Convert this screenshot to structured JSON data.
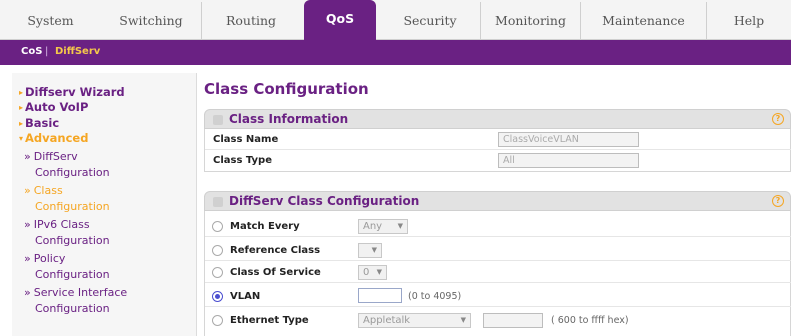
{
  "top_tabs": [
    "System",
    "Switching",
    "Routing",
    "QoS",
    "Security",
    "Monitoring",
    "Maintenance",
    "Help"
  ],
  "active_tab": "QoS",
  "sub_nav": {
    "items": [
      "CoS",
      "DiffServ"
    ],
    "divider": "|",
    "active": "DiffServ"
  },
  "sidebar": {
    "diffserv_wizard": "Diffserv Wizard",
    "auto_voip": "Auto VoIP",
    "basic": "Basic",
    "advanced": "Advanced",
    "diffserv_line1": "DiffServ",
    "diffserv_line2": "Configuration",
    "class_line1": "Class",
    "class_line2": "Configuration",
    "ipv6_line1": "IPv6 Class",
    "ipv6_line2": "Configuration",
    "policy_line1": "Policy",
    "policy_line2": "Configuration",
    "service_line1": "Service Interface",
    "service_line2": "Configuration"
  },
  "page_title": "Class Configuration",
  "class_info": {
    "header": "Class Information",
    "name_label": "Class Name",
    "name_value": "ClassVoiceVLAN",
    "type_label": "Class Type",
    "type_value": "All"
  },
  "diffserv_config": {
    "header": "DiffServ Class Configuration",
    "match_every_label": "Match Every",
    "match_every_value": "Any",
    "reference_class_label": "Reference Class",
    "reference_class_value": "",
    "cos_label": "Class Of Service",
    "cos_value": "0",
    "vlan_label": "VLAN",
    "vlan_value": "",
    "vlan_hint": "(0 to 4095)",
    "ethertype_label": "Ethernet Type",
    "ethertype_value": "Appletalk",
    "ethertype_custom_value": "",
    "ethertype_hint": "( 600 to ffff hex)",
    "selected_option": "VLAN"
  },
  "colors": {
    "accent_purple": "#6a2183",
    "accent_orange": "#f5a623",
    "radio_blue": "#4b4fd0"
  },
  "icons": {
    "help": "help-circle-icon"
  }
}
